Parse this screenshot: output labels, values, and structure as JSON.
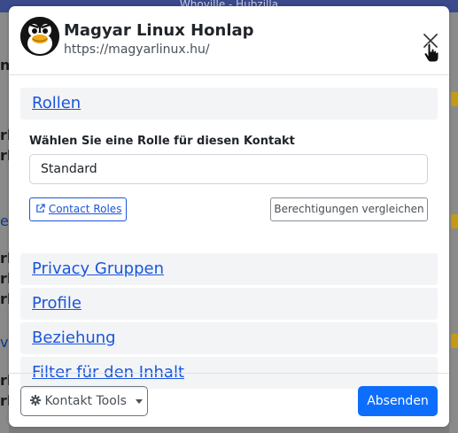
{
  "background": {
    "topbar_text": "Whoville - Hubzilla",
    "fragments": [
      "ng",
      "rb",
      "rb",
      "e",
      "rb",
      "rb",
      "rb",
      "v",
      "rb",
      "rb"
    ]
  },
  "header": {
    "title": "Magyar Linux Honlap",
    "url": "https://magyarlinux.hu/",
    "close_icon": "close-icon"
  },
  "accordion": {
    "roles": "Rollen",
    "privacy_groups": "Privacy Gruppen",
    "profiles": "Profile",
    "relationship": "Beziehung",
    "content_filter": "Filter für den Inhalt"
  },
  "roles_section": {
    "label": "Wählen Sie eine Rolle für diesen Kontakt",
    "selected_value": "Standard",
    "contact_roles_button": "Contact Roles",
    "compare_button": "Berechtigungen vergleichen"
  },
  "footer": {
    "tools_button": "Kontakt Tools",
    "submit_button": "Absenden"
  },
  "colors": {
    "primary": "#0d6efd",
    "link": "#1a56db"
  }
}
